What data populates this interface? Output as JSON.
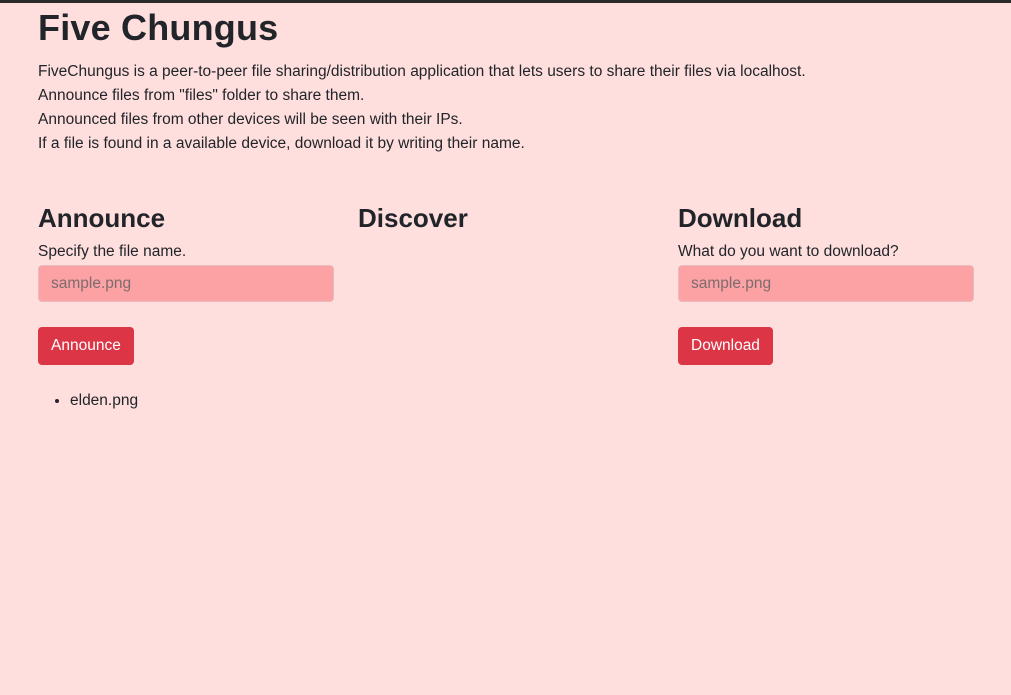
{
  "app": {
    "title": "Five Chungus",
    "intro": [
      "FiveChungus is a peer-to-peer file sharing/distribution application that lets users to share their files via localhost.",
      "Announce files from \"files\" folder to share them.",
      "Announced files from other devices will be seen with their IPs.",
      "If a file is found in a available device, download it by writing their name."
    ]
  },
  "announce": {
    "heading": "Announce",
    "label": "Specify the file name.",
    "input_value": "",
    "placeholder": "sample.png",
    "button_label": "Announce",
    "files": [
      "elden.png"
    ]
  },
  "discover": {
    "heading": "Discover"
  },
  "download": {
    "heading": "Download",
    "label": "What do you want to download?",
    "input_value": "",
    "placeholder": "sample.png",
    "button_label": "Download"
  },
  "colors": {
    "background": "#ffdede",
    "input_background": "#fca1a4",
    "button": "#dc3545",
    "text": "#212529"
  }
}
